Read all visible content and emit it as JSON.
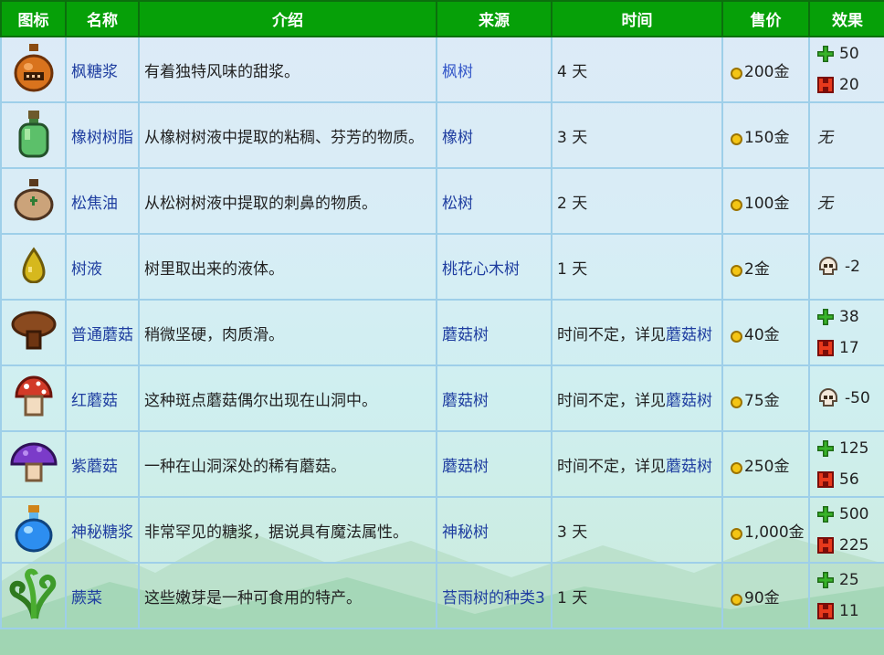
{
  "headers": [
    "图标",
    "名称",
    "介绍",
    "来源",
    "时间",
    "售价",
    "效果"
  ],
  "rows": [
    {
      "icon": "maple-syrup-icon",
      "name": "枫糖浆",
      "desc": "有着独特风味的甜浆。",
      "source": "枫树",
      "time": "4 天",
      "time_link": "",
      "price": "200金",
      "effects": [
        {
          "icon": "energy-plus-icon",
          "value": "50"
        },
        {
          "icon": "health-icon",
          "value": "20"
        }
      ]
    },
    {
      "icon": "oak-resin-icon",
      "name": "橡树树脂",
      "desc": "从橡树树液中提取的粘稠、芬芳的物质。",
      "source": "橡树",
      "time": "3 天",
      "time_link": "",
      "price": "150金",
      "effects_none": "无"
    },
    {
      "icon": "pine-tar-icon",
      "name": "松焦油",
      "desc": "从松树树液中提取的刺鼻的物质。",
      "source": "松树",
      "time": "2 天",
      "time_link": "",
      "price": "100金",
      "effects_none": "无"
    },
    {
      "icon": "sap-icon",
      "name": "树液",
      "desc": "树里取出来的液体。",
      "source": "桃花心木树",
      "time": "1 天",
      "time_link": "",
      "price": "2金",
      "effects": [
        {
          "icon": "skull-icon",
          "value": "-2"
        }
      ]
    },
    {
      "icon": "common-mushroom-icon",
      "name": "普通蘑菇",
      "desc": "稍微坚硬，肉质滑。",
      "source": "蘑菇树",
      "time": "时间不定，详见",
      "time_link": "蘑菇树",
      "price": "40金",
      "effects": [
        {
          "icon": "energy-plus-icon",
          "value": "38"
        },
        {
          "icon": "health-icon",
          "value": "17"
        }
      ]
    },
    {
      "icon": "red-mushroom-icon",
      "name": "红蘑菇",
      "desc": "这种斑点蘑菇偶尔出现在山洞中。",
      "source": "蘑菇树",
      "time": "时间不定，详见",
      "time_link": "蘑菇树",
      "price": "75金",
      "effects": [
        {
          "icon": "skull-icon",
          "value": "-50"
        }
      ]
    },
    {
      "icon": "purple-mushroom-icon",
      "name": "紫蘑菇",
      "desc": "一种在山洞深处的稀有蘑菇。",
      "source": "蘑菇树",
      "time": "时间不定，详见",
      "time_link": "蘑菇树",
      "price": "250金",
      "effects": [
        {
          "icon": "energy-plus-icon",
          "value": "125"
        },
        {
          "icon": "health-icon",
          "value": "56"
        }
      ]
    },
    {
      "icon": "mystic-syrup-icon",
      "name": "神秘糖浆",
      "desc": "非常罕见的糖浆，据说具有魔法属性。",
      "source": "神秘树",
      "time": "3 天",
      "time_link": "",
      "price": "1,000金",
      "effects": [
        {
          "icon": "energy-plus-icon",
          "value": "500"
        },
        {
          "icon": "health-icon",
          "value": "225"
        }
      ]
    },
    {
      "icon": "fiddlehead-fern-icon",
      "name": "蕨菜",
      "desc": "这些嫩芽是一种可食用的特产。",
      "source": "苔雨树的种类3",
      "time": "1 天",
      "time_link": "",
      "price": "90金",
      "effects": [
        {
          "icon": "energy-plus-icon",
          "value": "25"
        },
        {
          "icon": "health-icon",
          "value": "11"
        }
      ]
    }
  ],
  "colors": {
    "header_bg": "#06a008",
    "link": "#1f3ea0",
    "coin": "#f4c515"
  }
}
